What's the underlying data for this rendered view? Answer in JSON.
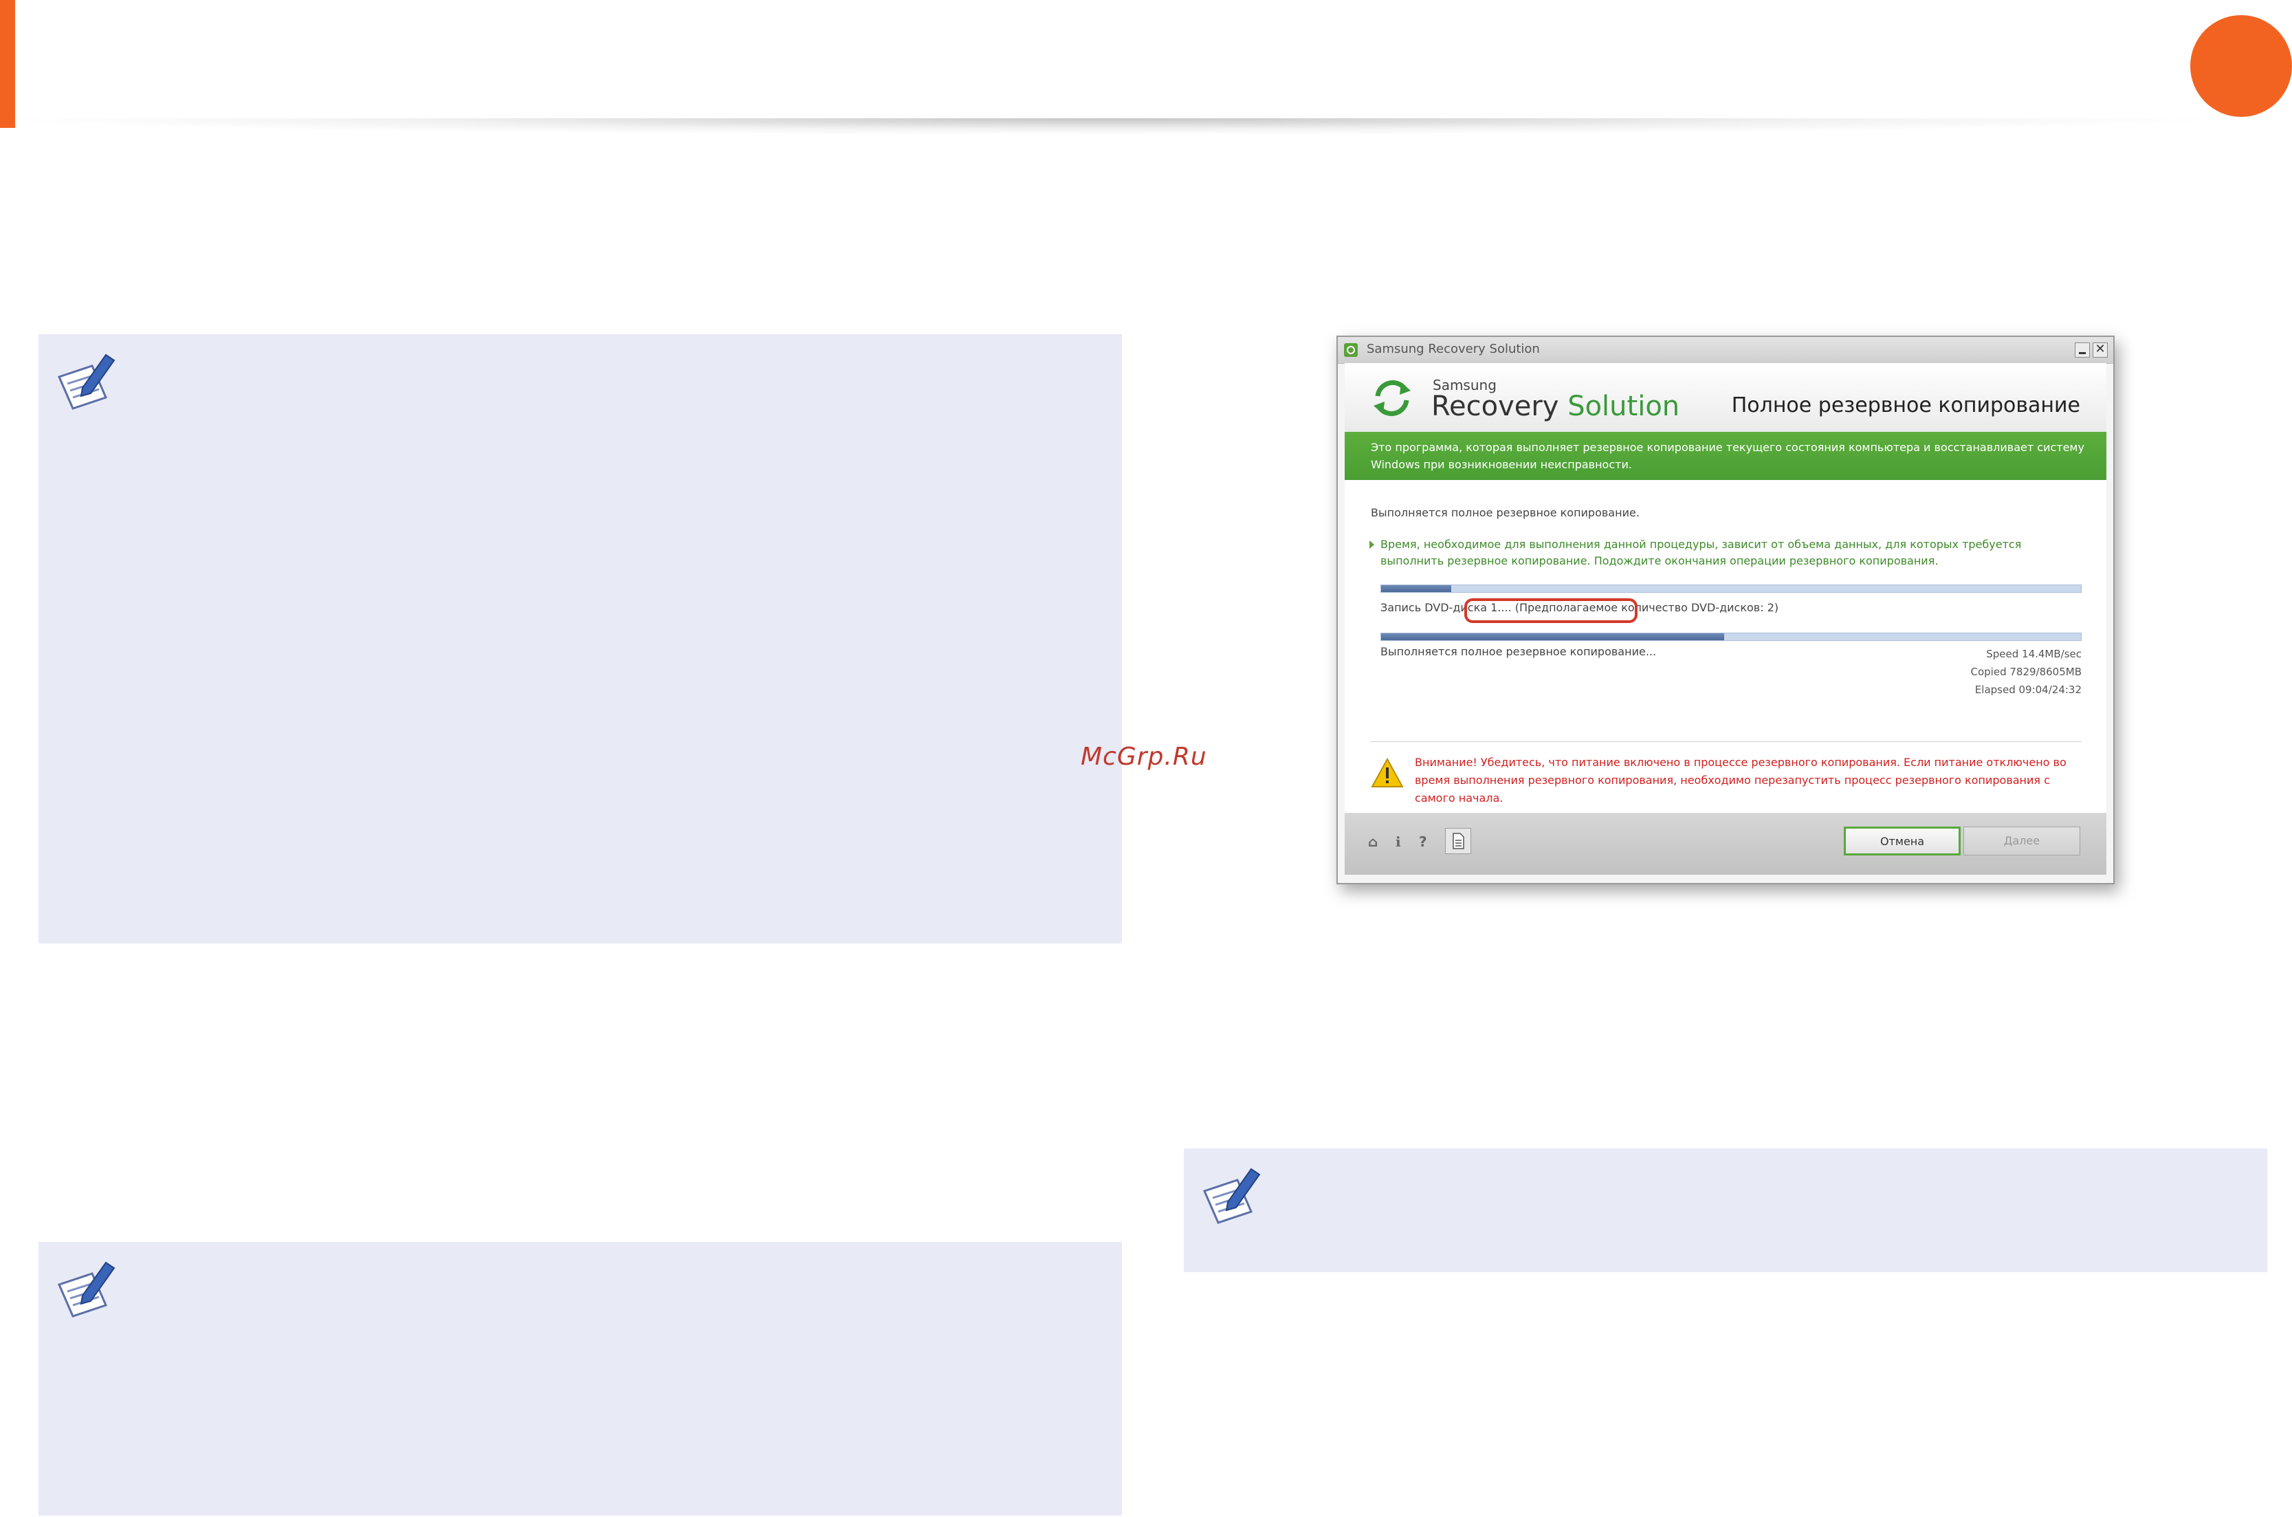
{
  "watermark": "McGrp.Ru",
  "colors": {
    "accent_orange": "#f26322",
    "note_bg": "#e8eaf6",
    "brand_green": "#4a9e33",
    "warning_red": "#d01f1f"
  },
  "icons": {
    "note": "note-pencil-icon",
    "window": "app-icon",
    "logo": "recovery-refresh-icon",
    "warning": "warning-triangle-icon"
  },
  "window": {
    "title": "Samsung Recovery Solution",
    "close_glyph": "✕",
    "brand": {
      "samsung": "Samsung",
      "recovery": "Recovery",
      "solution": "Solution"
    },
    "page_heading": "Полное резервное копирование",
    "banner_text": "Это программа, которая выполняет резервное копирование текущего состояния компьютера и восстанавливает систему Windows при возникновении неисправности.",
    "status_main": "Выполняется полное резервное копирование.",
    "green_note": "Время, необходимое для выполнения данной процедуры, зависит от объема данных, для которых требуется выполнить резервное копирование. Подождите окончания операции резервного копирования.",
    "progress_overall": 0.1,
    "dvd_status": "Запись DVD-диска 1.... (Предполагаемое количество DVD-дисков: 2)",
    "progress_current": 0.49,
    "status_sub": "Выполняется полное резервное копирование...",
    "stats": {
      "speed": "Speed 14.4MB/sec",
      "copied": "Copied 7829/8605MB",
      "elapsed": "Elapsed 09:04/24:32"
    },
    "warning": "Внимание! Убедитесь, что питание включено в процессе резервного копирования. Если питание отключено во время выполнения резервного копирования, необходимо перезапустить процесс резервного копирования с самого начала.",
    "footer": {
      "home_glyph": "⌂",
      "info_glyph": "i",
      "help_glyph": "?"
    },
    "buttons": {
      "cancel": "Отмена",
      "next": "Далее"
    }
  }
}
